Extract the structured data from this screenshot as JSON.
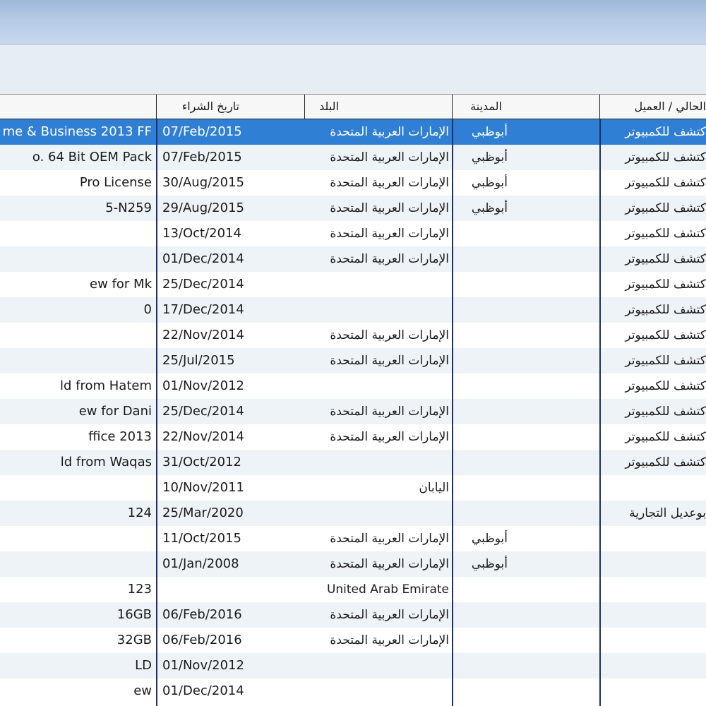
{
  "headers": {
    "purchase_date": "تاريخ الشراء",
    "country": "البلد",
    "city": "المدينة",
    "customer": "الحالي / العميل"
  },
  "rows": [
    {
      "product": "me & Business 2013 FF",
      "date": "07/Feb/2015",
      "country": "الإمارات العربية المتحدة",
      "city": "أبوظبي",
      "customer": "كتشف للكمبيوتر",
      "selected": true
    },
    {
      "product": "o. 64 Bit OEM Pack",
      "date": "07/Feb/2015",
      "country": "الإمارات العربية المتحدة",
      "city": "أبوظبي",
      "customer": "كتشف للكمبيوتر"
    },
    {
      "product": "Pro License",
      "date": "30/Aug/2015",
      "country": "الإمارات العربية المتحدة",
      "city": "أبوظبي",
      "customer": "كتشف للكمبيوتر"
    },
    {
      "product": "5-N259",
      "date": "29/Aug/2015",
      "country": "الإمارات العربية المتحدة",
      "city": "أبوظبي",
      "customer": "كتشف للكمبيوتر"
    },
    {
      "product": "",
      "date": "13/Oct/2014",
      "country": "الإمارات العربية المتحدة",
      "city": "",
      "customer": "كتشف للكمبيوتر"
    },
    {
      "product": "",
      "date": "01/Dec/2014",
      "country": "الإمارات العربية المتحدة",
      "city": "",
      "customer": "كتشف للكمبيوتر"
    },
    {
      "product": "ew for Mk",
      "date": "25/Dec/2014",
      "country": "",
      "city": "",
      "customer": "كتشف للكمبيوتر"
    },
    {
      "product": "0",
      "date": "17/Dec/2014",
      "country": "",
      "city": "",
      "customer": "كتشف للكمبيوتر"
    },
    {
      "product": "",
      "date": "22/Nov/2014",
      "country": "الإمارات العربية المتحدة",
      "city": "",
      "customer": "كتشف للكمبيوتر"
    },
    {
      "product": "",
      "date": "25/Jul/2015",
      "country": "الإمارات العربية المتحدة",
      "city": "",
      "customer": "كتشف للكمبيوتر"
    },
    {
      "product": "ld  from Hatem",
      "date": "01/Nov/2012",
      "country": "",
      "city": "",
      "customer": "كتشف للكمبيوتر"
    },
    {
      "product": "ew for Dani",
      "date": "25/Dec/2014",
      "country": "الإمارات العربية المتحدة",
      "city": "",
      "customer": "كتشف للكمبيوتر"
    },
    {
      "product": "ffice 2013",
      "date": "22/Nov/2014",
      "country": "الإمارات العربية المتحدة",
      "city": "",
      "customer": "كتشف للكمبيوتر"
    },
    {
      "product": "ld  from Waqas",
      "date": "31/Oct/2012",
      "country": "",
      "city": "",
      "customer": "كتشف للكمبيوتر"
    },
    {
      "product": "",
      "date": "10/Nov/2011",
      "country": "اليابان",
      "city": "",
      "customer": ""
    },
    {
      "product": "124",
      "date": "25/Mar/2020",
      "country": "",
      "city": "",
      "customer": "بوعديل التجارية"
    },
    {
      "product": "",
      "date": "11/Oct/2015",
      "country": "الإمارات العربية المتحدة",
      "city": "أبوظبي",
      "customer": ""
    },
    {
      "product": "",
      "date": "01/Jan/2008",
      "country": "الإمارات العربية المتحدة",
      "city": "أبوظبي",
      "customer": ""
    },
    {
      "product": "123",
      "date": "",
      "country": "United Arab Emirate",
      "city": "",
      "customer": ""
    },
    {
      "product": "16GB",
      "date": "06/Feb/2016",
      "country": "الإمارات العربية المتحدة",
      "city": "",
      "customer": ""
    },
    {
      "product": "32GB",
      "date": "06/Feb/2016",
      "country": "الإمارات العربية المتحدة",
      "city": "",
      "customer": ""
    },
    {
      "product": "LD",
      "date": "01/Nov/2012",
      "country": "",
      "city": "",
      "customer": ""
    },
    {
      "product": "ew",
      "date": "01/Dec/2014",
      "country": "",
      "city": "",
      "customer": ""
    }
  ]
}
